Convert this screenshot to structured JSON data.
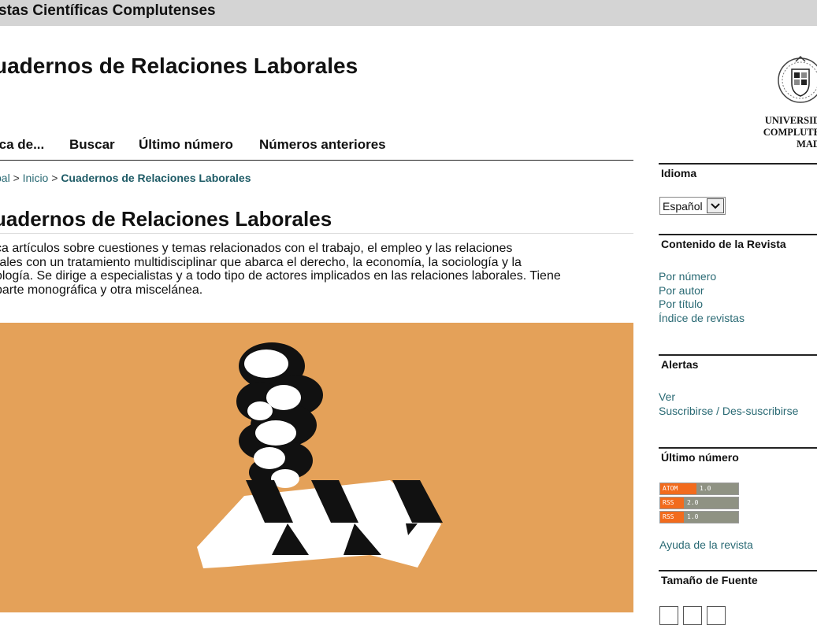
{
  "topbar": {
    "title": "stas Científicas Complutenses"
  },
  "header": {
    "journal_title": "uadernos de Relaciones Laborales",
    "logo_text": [
      "UNIVERSIDA",
      "COMPLUTEN",
      "MADR"
    ]
  },
  "nav": {
    "items": [
      "rca de...",
      "Buscar",
      "Último número",
      "Números anteriores"
    ]
  },
  "breadcrumb": {
    "part1": "pal",
    "sep": ">",
    "part2": "Inicio",
    "current": "Cuadernos de Relaciones Laborales"
  },
  "main": {
    "heading": "uadernos de Relaciones Laborales",
    "description_lines": [
      "ca artículos sobre cuestiones y temas relacionados con el trabajo, el empleo y las relaciones",
      "rales con un tratamiento multidisciplinar que abarca el derecho, la economía, la sociología y la",
      "ología. Se dirige a especialistas y a todo tipo de actores implicados en las relaciones laborales. Tiene",
      "parte monográfica y otra miscelánea."
    ],
    "cover_bg": "#e4a159"
  },
  "sidebar": {
    "language": {
      "title": "Idioma",
      "selected": "Español"
    },
    "content": {
      "title": "Contenido de la Revista",
      "links": [
        "Por número",
        "Por autor",
        "Por título",
        "Índice de revistas"
      ]
    },
    "alerts": {
      "title": "Alertas",
      "links": [
        "Ver",
        "Suscribirse / Des-suscribirse"
      ]
    },
    "latest": {
      "title": "Último número",
      "feeds": [
        {
          "label": "ATOM",
          "version": "1.0"
        },
        {
          "label": "RSS",
          "version": "2.0"
        },
        {
          "label": "RSS",
          "version": "1.0"
        }
      ],
      "help_link": "Ayuda de la revista"
    },
    "font_size": {
      "title": "Tamaño de Fuente"
    }
  },
  "colors": {
    "link": "#2a6a74",
    "topbar": "#d4d4d4",
    "feed_label": "#f26b1d",
    "feed_version": "#8f9283"
  }
}
